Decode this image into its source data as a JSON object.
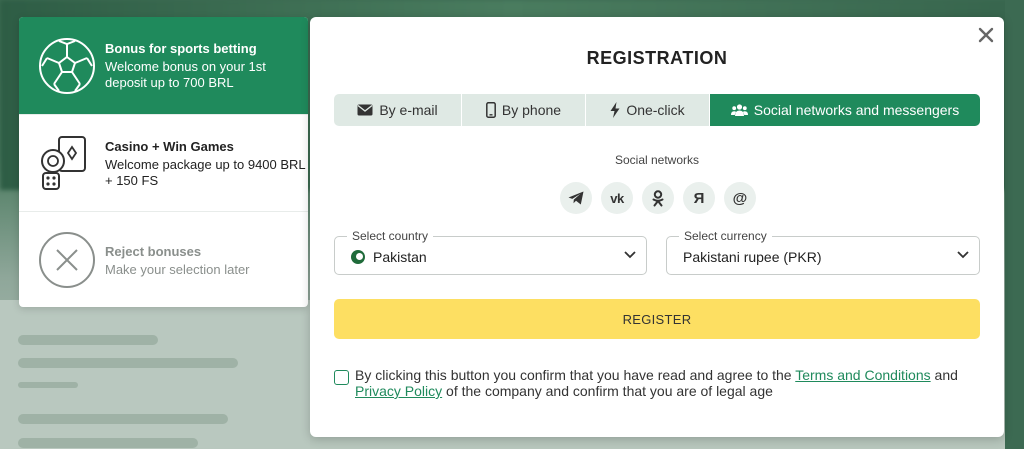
{
  "bonuses": [
    {
      "title": "Bonus for sports betting",
      "desc": "Welcome bonus on your 1st deposit up to 700 BRL",
      "icon": "soccer-ball-icon",
      "active": true
    },
    {
      "title": "Casino + Win Games",
      "desc": "Welcome package up to 9400 BRL + 150 FS",
      "icon": "casino-cards-icon",
      "active": false
    },
    {
      "title": "Reject bonuses",
      "desc": "Make your selection later",
      "icon": "close-circle-icon",
      "active": false
    }
  ],
  "modal": {
    "title": "REGISTRATION",
    "tabs": [
      {
        "label": "By e-mail",
        "icon": "envelope-icon"
      },
      {
        "label": "By phone",
        "icon": "phone-icon"
      },
      {
        "label": "One-click",
        "icon": "lightning-icon"
      },
      {
        "label": "Social networks and messengers",
        "icon": "users-icon",
        "active": true
      }
    ],
    "social_label": "Social networks",
    "socials": [
      {
        "name": "telegram",
        "icon": "telegram-icon"
      },
      {
        "name": "vk",
        "glyph": "vk",
        "icon": "vk-icon"
      },
      {
        "name": "odnoklassniki",
        "icon": "odnoklassniki-icon"
      },
      {
        "name": "yandex",
        "glyph": "Я",
        "icon": "yandex-icon"
      },
      {
        "name": "mail",
        "glyph": "@",
        "icon": "mail-at-icon"
      }
    ],
    "country": {
      "label": "Select country",
      "value": "Pakistan"
    },
    "currency": {
      "label": "Select currency",
      "value": "Pakistani rupee (PKR)"
    },
    "register_label": "REGISTER",
    "agree": {
      "text1": "By clicking this button you confirm that you have read and agree to the ",
      "terms_link": "Terms and Conditions",
      "text2": " and ",
      "privacy_link": "Privacy Policy",
      "text3": " of the company and confirm that you are of legal age"
    }
  },
  "colors": {
    "accent": "#1f8a5c",
    "register": "#fddf62"
  }
}
